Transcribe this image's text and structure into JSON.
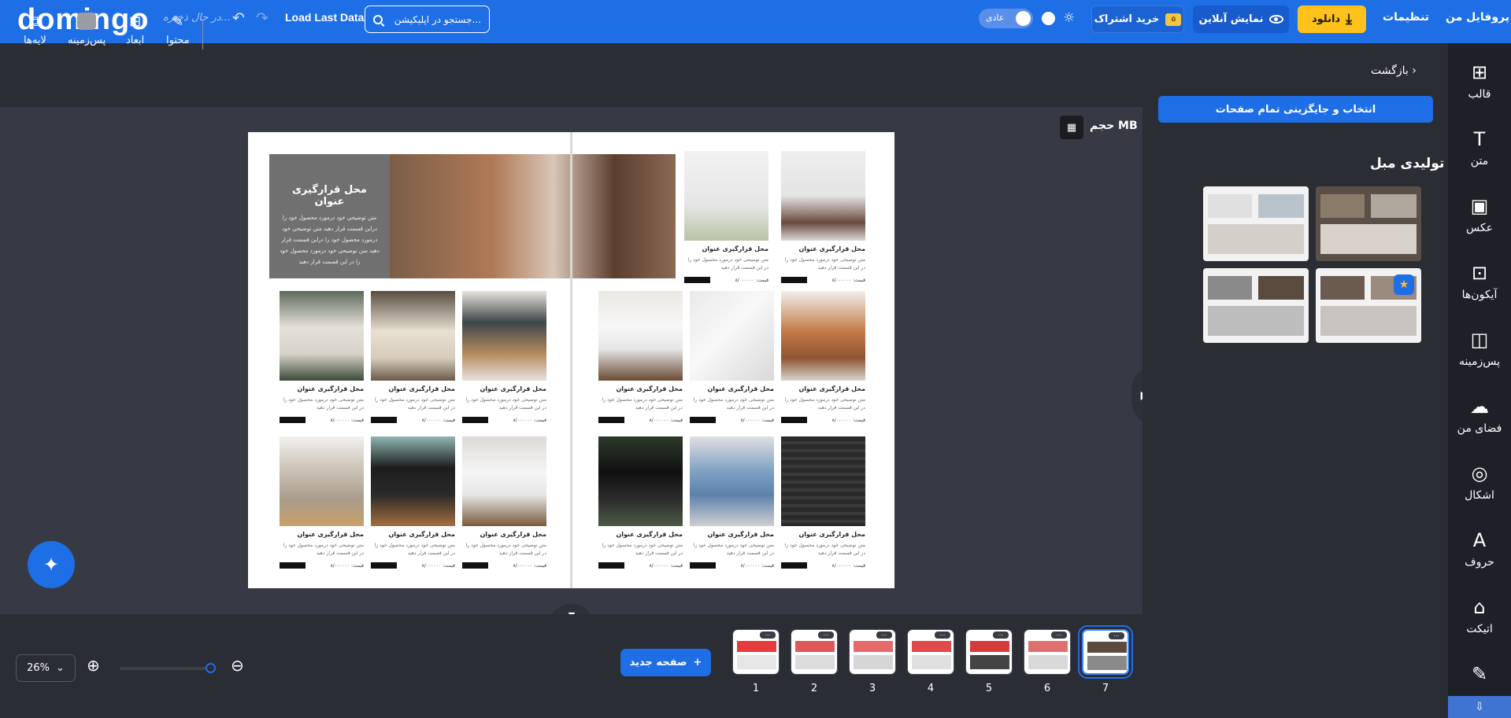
{
  "topbar": {
    "logo": "domingo",
    "saving_status": "در حال ذخیره...",
    "load_last": "Load Last Data",
    "search_placeholder": "جستجو در اپلیکیشن...",
    "theme_mode": "عادی",
    "subscribe": "خرید اشتراک",
    "crown_badge": "۵",
    "online_preview": "نمایش آنلاین",
    "download": "دانلود",
    "settings": "تنظیمات",
    "profile": "پروفایل من"
  },
  "toolbar": {
    "content": "محتوا",
    "dimensions": "ابعاد",
    "background": "پس‌زمینه",
    "layers": "لایه‌ها"
  },
  "canvas": {
    "size_label": "حجم MB",
    "hero_title": "محل قرارگیری عنوان",
    "hero_desc": "متن توضیحی خود درمورد محصول خود را درابن قسمت قرار دهید متن توضیحی خود درمورد محصول خود را دراین قسمت قرار دهید متن توضیحی خود درمورد محصول خود را در این قسمت قرار دهید",
    "card_title": "محل قرارگیری عنوان",
    "card_desc": "متن توضیحی خود درمورد محصول خود را در این قسمت قرار دهید",
    "card_price": "قیمت: ۸/۰۰۰۰۰۰",
    "card_colors_top": [
      "#a8b6a0",
      "#e2e0dc",
      "#ece8e4",
      "#e7e2df"
    ],
    "card_colors_mid": [
      "#6f7a68",
      "#cbbfae",
      "#9c7a5c",
      "#6d5544",
      "#dcdcdc",
      "#b38a6a"
    ],
    "card_colors_bot": [
      "#cfc8bf",
      "#8fb4b2",
      "#d9d6d0",
      "#2c2c2c",
      "#8aa6c2",
      "#3a3a3a"
    ]
  },
  "bottombar": {
    "zoom_value": "26%",
    "new_page": "صفحه جدید",
    "pages": [
      "1",
      "2",
      "3",
      "4",
      "5",
      "6",
      "7"
    ],
    "page_accents": [
      "#e63b3b",
      "#e05757",
      "#e66a6a",
      "#e04a4a",
      "#d63b3b",
      "#e07070",
      "#5c4a40"
    ],
    "thumb_menu": "..."
  },
  "panel": {
    "back": "بازگشت",
    "replace_all": "انتخاب و جایگزینی تمام صفحات",
    "section_title": "تولیدی مبل"
  },
  "sidebar": {
    "items": [
      "قالب",
      "متن",
      "عکس",
      "آیکون‌ها",
      "پس‌زمینه",
      "فضای من",
      "اشکال",
      "حروف",
      "اتیکت"
    ],
    "icons": [
      "template-icon",
      "text-icon",
      "photo-icon",
      "icons-icon",
      "background-icon",
      "cloud-icon",
      "shapes-icon",
      "font-icon",
      "tag-icon"
    ]
  },
  "colors": {
    "brand": "#1e6ee6",
    "accent": "#ffc21a",
    "canvas_bg": "#373a44"
  }
}
